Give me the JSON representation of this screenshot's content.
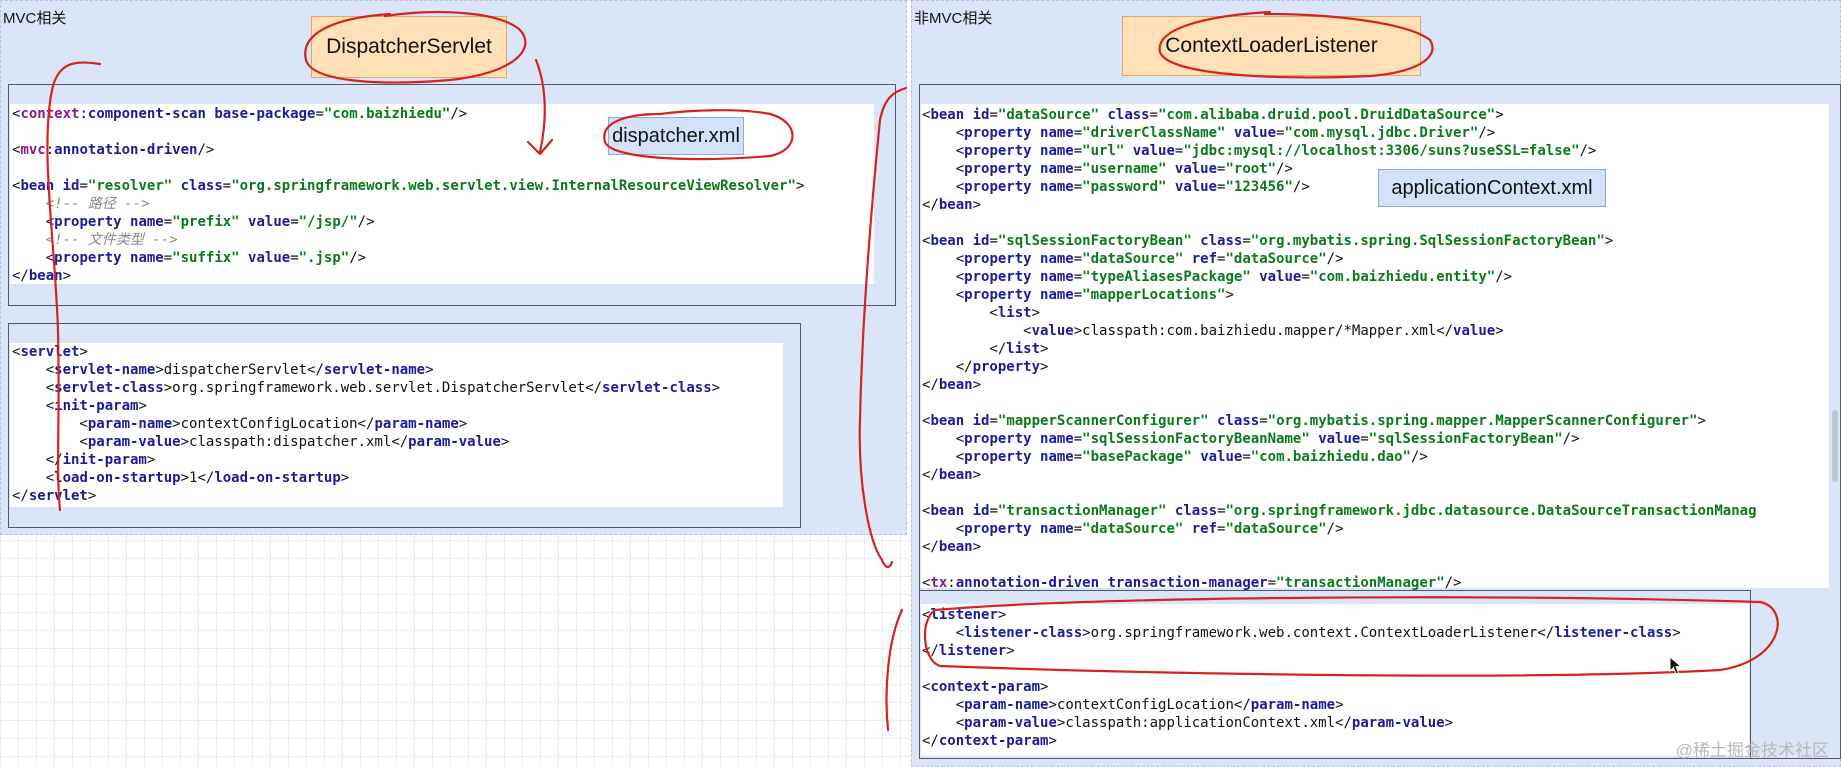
{
  "left_panel": {
    "label": "MVC相关",
    "note": "DispatcherServlet",
    "tag": "dispatcher.xml"
  },
  "right_panel": {
    "label": "非MVC相关",
    "note": "ContextLoaderListener",
    "tag": "applicationContext.xml"
  },
  "watermark": "@稀土掘金技术社区",
  "code": {
    "dispatcher_xml": [
      [
        [
          "p",
          "<"
        ],
        [
          "ns",
          "context"
        ],
        [
          "p",
          ":"
        ],
        [
          "t",
          "component-scan "
        ],
        [
          "a",
          "base-package"
        ],
        [
          "p",
          "="
        ],
        [
          "v",
          "\"com.baizhiedu\""
        ],
        [
          "p",
          "/>"
        ]
      ],
      [],
      [
        [
          "p",
          "<"
        ],
        [
          "ns",
          "mvc"
        ],
        [
          "p",
          ":"
        ],
        [
          "t",
          "annotation-driven"
        ],
        [
          "p",
          "/>"
        ]
      ],
      [],
      [
        [
          "p",
          "<"
        ],
        [
          "t",
          "bean "
        ],
        [
          "a",
          "id"
        ],
        [
          "p",
          "="
        ],
        [
          "v",
          "\"resolver\" "
        ],
        [
          "a",
          "class"
        ],
        [
          "p",
          "="
        ],
        [
          "v",
          "\"org.springframework.web.servlet.view.InternalResourceViewResolver\""
        ],
        [
          "p",
          ">"
        ]
      ],
      [
        [
          "p",
          "    "
        ],
        [
          "c",
          "<!-- 路径 -->"
        ]
      ],
      [
        [
          "p",
          "    <"
        ],
        [
          "t",
          "property "
        ],
        [
          "a",
          "name"
        ],
        [
          "p",
          "="
        ],
        [
          "v",
          "\"prefix\" "
        ],
        [
          "a",
          "value"
        ],
        [
          "p",
          "="
        ],
        [
          "v",
          "\"/jsp/\""
        ],
        [
          "p",
          "/>"
        ]
      ],
      [
        [
          "p",
          "    "
        ],
        [
          "c",
          "<!-- 文件类型 -->"
        ]
      ],
      [
        [
          "p",
          "    <"
        ],
        [
          "t",
          "property "
        ],
        [
          "a",
          "name"
        ],
        [
          "p",
          "="
        ],
        [
          "v",
          "\"suffix\" "
        ],
        [
          "a",
          "value"
        ],
        [
          "p",
          "="
        ],
        [
          "v",
          "\".jsp\""
        ],
        [
          "p",
          "/>"
        ]
      ],
      [
        [
          "p",
          "</"
        ],
        [
          "t",
          "bean"
        ],
        [
          "p",
          ">"
        ]
      ]
    ],
    "servlet": [
      [
        [
          "p",
          "<"
        ],
        [
          "t",
          "servlet"
        ],
        [
          "p",
          ">"
        ]
      ],
      [
        [
          "p",
          "    <"
        ],
        [
          "t",
          "servlet-name"
        ],
        [
          "p",
          ">"
        ],
        [
          "txt",
          "dispatcherServlet"
        ],
        [
          "p",
          "</"
        ],
        [
          "t",
          "servlet-name"
        ],
        [
          "p",
          ">"
        ]
      ],
      [
        [
          "p",
          "    <"
        ],
        [
          "t",
          "servlet-class"
        ],
        [
          "p",
          ">"
        ],
        [
          "txt",
          "org.springframework.web.servlet.DispatcherServlet"
        ],
        [
          "p",
          "</"
        ],
        [
          "t",
          "servlet-class"
        ],
        [
          "p",
          ">"
        ]
      ],
      [
        [
          "p",
          "    <"
        ],
        [
          "t",
          "init-param"
        ],
        [
          "p",
          ">"
        ]
      ],
      [
        [
          "p",
          "        <"
        ],
        [
          "t",
          "param-name"
        ],
        [
          "p",
          ">"
        ],
        [
          "txt",
          "contextConfigLocation"
        ],
        [
          "p",
          "</"
        ],
        [
          "t",
          "param-name"
        ],
        [
          "p",
          ">"
        ]
      ],
      [
        [
          "p",
          "        <"
        ],
        [
          "t",
          "param-value"
        ],
        [
          "p",
          ">"
        ],
        [
          "txt",
          "classpath:dispatcher.xml"
        ],
        [
          "p",
          "</"
        ],
        [
          "t",
          "param-value"
        ],
        [
          "p",
          ">"
        ]
      ],
      [
        [
          "p",
          "    </"
        ],
        [
          "t",
          "init-param"
        ],
        [
          "p",
          ">"
        ]
      ],
      [
        [
          "p",
          "    <"
        ],
        [
          "t",
          "load-on-startup"
        ],
        [
          "p",
          ">"
        ],
        [
          "txt",
          "1"
        ],
        [
          "p",
          "</"
        ],
        [
          "t",
          "load-on-startup"
        ],
        [
          "p",
          ">"
        ]
      ],
      [
        [
          "p",
          "</"
        ],
        [
          "t",
          "servlet"
        ],
        [
          "p",
          ">"
        ]
      ]
    ],
    "application_context_xml": [
      [
        [
          "p",
          "<"
        ],
        [
          "t",
          "bean "
        ],
        [
          "a",
          "id"
        ],
        [
          "p",
          "="
        ],
        [
          "v",
          "\"dataSource\" "
        ],
        [
          "a",
          "class"
        ],
        [
          "p",
          "="
        ],
        [
          "v",
          "\"com.alibaba.druid.pool.DruidDataSource\""
        ],
        [
          "p",
          ">"
        ]
      ],
      [
        [
          "p",
          "    <"
        ],
        [
          "t",
          "property "
        ],
        [
          "a",
          "name"
        ],
        [
          "p",
          "="
        ],
        [
          "v",
          "\"driverClassName\" "
        ],
        [
          "a",
          "value"
        ],
        [
          "p",
          "="
        ],
        [
          "v",
          "\"com.mysql.jdbc.Driver\""
        ],
        [
          "p",
          "/>"
        ]
      ],
      [
        [
          "p",
          "    <"
        ],
        [
          "t",
          "property "
        ],
        [
          "a",
          "name"
        ],
        [
          "p",
          "="
        ],
        [
          "v",
          "\"url\" "
        ],
        [
          "a",
          "value"
        ],
        [
          "p",
          "="
        ],
        [
          "v",
          "\"jdbc:mysql://localhost:3306/suns?useSSL=false\""
        ],
        [
          "p",
          "/>"
        ]
      ],
      [
        [
          "p",
          "    <"
        ],
        [
          "t",
          "property "
        ],
        [
          "a",
          "name"
        ],
        [
          "p",
          "="
        ],
        [
          "v",
          "\"username\" "
        ],
        [
          "a",
          "value"
        ],
        [
          "p",
          "="
        ],
        [
          "v",
          "\"root\""
        ],
        [
          "p",
          "/>"
        ]
      ],
      [
        [
          "p",
          "    <"
        ],
        [
          "t",
          "property "
        ],
        [
          "a",
          "name"
        ],
        [
          "p",
          "="
        ],
        [
          "v",
          "\"password\" "
        ],
        [
          "a",
          "value"
        ],
        [
          "p",
          "="
        ],
        [
          "v",
          "\"123456\""
        ],
        [
          "p",
          "/>"
        ]
      ],
      [
        [
          "p",
          "</"
        ],
        [
          "t",
          "bean"
        ],
        [
          "p",
          ">"
        ]
      ],
      [],
      [
        [
          "p",
          "<"
        ],
        [
          "t",
          "bean "
        ],
        [
          "a",
          "id"
        ],
        [
          "p",
          "="
        ],
        [
          "v",
          "\"sqlSessionFactoryBean\" "
        ],
        [
          "a",
          "class"
        ],
        [
          "p",
          "="
        ],
        [
          "v",
          "\"org.mybatis.spring.SqlSessionFactoryBean\""
        ],
        [
          "p",
          ">"
        ]
      ],
      [
        [
          "p",
          "    <"
        ],
        [
          "t",
          "property "
        ],
        [
          "a",
          "name"
        ],
        [
          "p",
          "="
        ],
        [
          "v",
          "\"dataSource\" "
        ],
        [
          "a",
          "ref"
        ],
        [
          "p",
          "="
        ],
        [
          "v",
          "\"dataSource\""
        ],
        [
          "p",
          "/>"
        ]
      ],
      [
        [
          "p",
          "    <"
        ],
        [
          "t",
          "property "
        ],
        [
          "a",
          "name"
        ],
        [
          "p",
          "="
        ],
        [
          "v",
          "\"typeAliasesPackage\" "
        ],
        [
          "a",
          "value"
        ],
        [
          "p",
          "="
        ],
        [
          "v",
          "\"com.baizhiedu.entity\""
        ],
        [
          "p",
          "/>"
        ]
      ],
      [
        [
          "p",
          "    <"
        ],
        [
          "t",
          "property "
        ],
        [
          "a",
          "name"
        ],
        [
          "p",
          "="
        ],
        [
          "v",
          "\"mapperLocations\""
        ],
        [
          "p",
          ">"
        ]
      ],
      [
        [
          "p",
          "        <"
        ],
        [
          "t",
          "list"
        ],
        [
          "p",
          ">"
        ]
      ],
      [
        [
          "p",
          "            <"
        ],
        [
          "t",
          "value"
        ],
        [
          "p",
          ">"
        ],
        [
          "txt",
          "classpath:com.baizhiedu.mapper/*Mapper.xml"
        ],
        [
          "p",
          "</"
        ],
        [
          "t",
          "value"
        ],
        [
          "p",
          ">"
        ]
      ],
      [
        [
          "p",
          "        </"
        ],
        [
          "t",
          "list"
        ],
        [
          "p",
          ">"
        ]
      ],
      [
        [
          "p",
          "    </"
        ],
        [
          "t",
          "property"
        ],
        [
          "p",
          ">"
        ]
      ],
      [
        [
          "p",
          "</"
        ],
        [
          "t",
          "bean"
        ],
        [
          "p",
          ">"
        ]
      ],
      [],
      [
        [
          "p",
          "<"
        ],
        [
          "t",
          "bean "
        ],
        [
          "a",
          "id"
        ],
        [
          "p",
          "="
        ],
        [
          "v",
          "\"mapperScannerConfigurer\" "
        ],
        [
          "a",
          "class"
        ],
        [
          "p",
          "="
        ],
        [
          "v",
          "\"org.mybatis.spring.mapper.MapperScannerConfigurer\""
        ],
        [
          "p",
          ">"
        ]
      ],
      [
        [
          "p",
          "    <"
        ],
        [
          "t",
          "property "
        ],
        [
          "a",
          "name"
        ],
        [
          "p",
          "="
        ],
        [
          "v",
          "\"sqlSessionFactoryBeanName\" "
        ],
        [
          "a",
          "value"
        ],
        [
          "p",
          "="
        ],
        [
          "v",
          "\"sqlSessionFactoryBean\""
        ],
        [
          "p",
          "/>"
        ]
      ],
      [
        [
          "p",
          "    <"
        ],
        [
          "t",
          "property "
        ],
        [
          "a",
          "name"
        ],
        [
          "p",
          "="
        ],
        [
          "v",
          "\"basePackage\" "
        ],
        [
          "a",
          "value"
        ],
        [
          "p",
          "="
        ],
        [
          "v",
          "\"com.baizhiedu.dao\""
        ],
        [
          "p",
          "/>"
        ]
      ],
      [
        [
          "p",
          "</"
        ],
        [
          "t",
          "bean"
        ],
        [
          "p",
          ">"
        ]
      ],
      [],
      [
        [
          "p",
          "<"
        ],
        [
          "t",
          "bean "
        ],
        [
          "a",
          "id"
        ],
        [
          "p",
          "="
        ],
        [
          "v",
          "\"transactionManager\" "
        ],
        [
          "a",
          "class"
        ],
        [
          "p",
          "="
        ],
        [
          "v",
          "\"org.springframework.jdbc.datasource.DataSourceTransactionManag"
        ]
      ],
      [
        [
          "p",
          "    <"
        ],
        [
          "t",
          "property "
        ],
        [
          "a",
          "name"
        ],
        [
          "p",
          "="
        ],
        [
          "v",
          "\"dataSource\" "
        ],
        [
          "a",
          "ref"
        ],
        [
          "p",
          "="
        ],
        [
          "v",
          "\"dataSource\""
        ],
        [
          "p",
          "/>"
        ]
      ],
      [
        [
          "p",
          "</"
        ],
        [
          "t",
          "bean"
        ],
        [
          "p",
          ">"
        ]
      ],
      [],
      [
        [
          "p",
          "<"
        ],
        [
          "ns",
          "tx"
        ],
        [
          "p",
          ":"
        ],
        [
          "t",
          "annotation-driven "
        ],
        [
          "a",
          "transaction-manager"
        ],
        [
          "p",
          "="
        ],
        [
          "v",
          "\"transactionManager\""
        ],
        [
          "p",
          "/>"
        ]
      ]
    ],
    "listener": [
      [
        [
          "p",
          "<"
        ],
        [
          "t",
          "listener"
        ],
        [
          "p",
          ">"
        ]
      ],
      [
        [
          "p",
          "    <"
        ],
        [
          "t",
          "listener-class"
        ],
        [
          "p",
          ">"
        ],
        [
          "txt",
          "org.springframework.web.context.ContextLoaderListener"
        ],
        [
          "p",
          "</"
        ],
        [
          "t",
          "listener-class"
        ],
        [
          "p",
          ">"
        ]
      ],
      [
        [
          "p",
          "</"
        ],
        [
          "t",
          "listener"
        ],
        [
          "p",
          ">"
        ]
      ],
      [],
      [
        [
          "p",
          "<"
        ],
        [
          "t",
          "context-param"
        ],
        [
          "p",
          ">"
        ]
      ],
      [
        [
          "p",
          "    <"
        ],
        [
          "t",
          "param-name"
        ],
        [
          "p",
          ">"
        ],
        [
          "txt",
          "contextConfigLocation"
        ],
        [
          "p",
          "</"
        ],
        [
          "t",
          "param-name"
        ],
        [
          "p",
          ">"
        ]
      ],
      [
        [
          "p",
          "    <"
        ],
        [
          "t",
          "param-value"
        ],
        [
          "p",
          ">"
        ],
        [
          "txt",
          "classpath:applicationContext.xml"
        ],
        [
          "p",
          "</"
        ],
        [
          "t",
          "param-value"
        ],
        [
          "p",
          ">"
        ]
      ],
      [
        [
          "p",
          "</"
        ],
        [
          "t",
          "context-param"
        ],
        [
          "p",
          ">"
        ]
      ]
    ]
  }
}
